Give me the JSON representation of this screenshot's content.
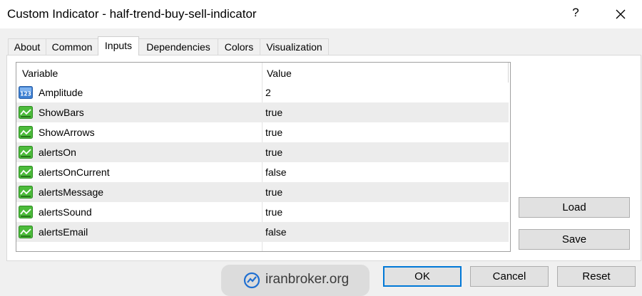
{
  "window": {
    "title": "Custom Indicator - half-trend-buy-sell-indicator",
    "help": "?"
  },
  "tabs": [
    {
      "label": "About"
    },
    {
      "label": "Common"
    },
    {
      "label": "Inputs",
      "active": true
    },
    {
      "label": "Dependencies"
    },
    {
      "label": "Colors"
    },
    {
      "label": "Visualization"
    }
  ],
  "grid": {
    "headers": {
      "variable": "Variable",
      "value": "Value"
    },
    "rows": [
      {
        "name": "Amplitude",
        "value": "2",
        "icon": "integer-123-icon"
      },
      {
        "name": "ShowBars",
        "value": "true",
        "icon": "bool-green-icon"
      },
      {
        "name": "ShowArrows",
        "value": "true",
        "icon": "bool-green-icon"
      },
      {
        "name": "alertsOn",
        "value": "true",
        "icon": "bool-green-icon"
      },
      {
        "name": "alertsOnCurrent",
        "value": "false",
        "icon": "bool-green-icon"
      },
      {
        "name": "alertsMessage",
        "value": "true",
        "icon": "bool-green-icon"
      },
      {
        "name": "alertsSound",
        "value": "true",
        "icon": "bool-green-icon"
      },
      {
        "name": "alertsEmail",
        "value": "false",
        "icon": "bool-green-icon"
      }
    ]
  },
  "side_buttons": {
    "load": "Load",
    "save": "Save"
  },
  "footer": {
    "ok": "OK",
    "cancel": "Cancel",
    "reset": "Reset"
  },
  "watermark": {
    "text": "iranbroker.org"
  },
  "colors": {
    "accent": "#0078d7",
    "bool_icon_green": "#4cbb3b",
    "int_icon_blue": "#3d7fd1"
  }
}
